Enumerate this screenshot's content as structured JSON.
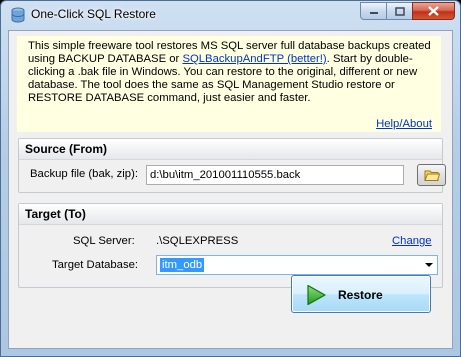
{
  "window": {
    "title": "One-Click SQL Restore"
  },
  "info": {
    "text_before_link": "This simple freeware tool restores MS SQL server full database backups created using BACKUP DATABASE or ",
    "link_text": "SQLBackupAndFTP (better!)",
    "text_after_link": ". Start by double-clicking a .bak file in Windows. You can restore to the original, different or new database. The tool does the same as SQL Management Studio restore or RESTORE DATABASE command, just easier and faster.",
    "help_link": "Help/About"
  },
  "source": {
    "title": "Source (From)",
    "backup_label": "Backup file (bak, zip):",
    "backup_value": "d:\\bu\\itm_201001110555.back"
  },
  "target": {
    "title": "Target (To)",
    "server_label": "SQL Server:",
    "server_value": ".\\SQLEXPRESS",
    "change_link": "Change",
    "db_label": "Target Database:",
    "db_value": "itm_odb"
  },
  "restore_button": "Restore",
  "colors": {
    "link": "#0033cc",
    "info_bg": "#ffffe1",
    "selection": "#3399ff",
    "close_button": "#c1301c"
  }
}
